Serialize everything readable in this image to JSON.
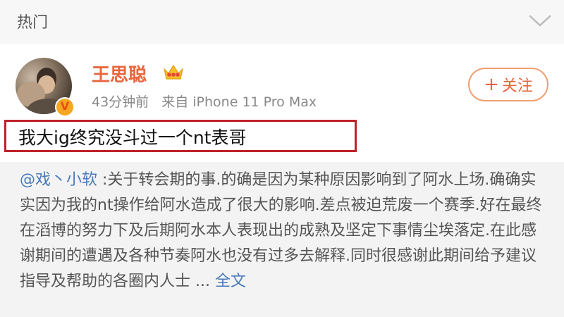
{
  "header": {
    "title": "热门",
    "chevron_icon": "chevron-down-icon"
  },
  "post": {
    "username": "王思聪",
    "crown_icon": "crown-icon",
    "verified_icon": "verified-v-icon",
    "verified_label": "V",
    "time": "43分钟前",
    "source": "来自 iPhone 11 Pro Max",
    "follow_plus": "+",
    "follow_label": "关注",
    "text": "我大ig终究没斗过一个nt表哥"
  },
  "repost": {
    "mention": "@戏丶小软",
    "body": " :关于转会期的事.的确是因为某种原因影响到了阿水上场.确确实实因为我的nt操作给阿水造成了很大的影响.差点被迫荒废一个赛季.好在最终在滔博的努力下及后期阿水本人表现出的成熟及坚定下事情尘埃落定.在此感谢期间的遭遇及各种节奏阿水也没有过多去解释.同时很感谢此期间给予建议指导及帮助的各圈内人士 ... ",
    "more_label": "全文"
  },
  "colors": {
    "username": "#e8663d",
    "link": "#4a7ab8",
    "highlight_border": "#c0202a"
  }
}
